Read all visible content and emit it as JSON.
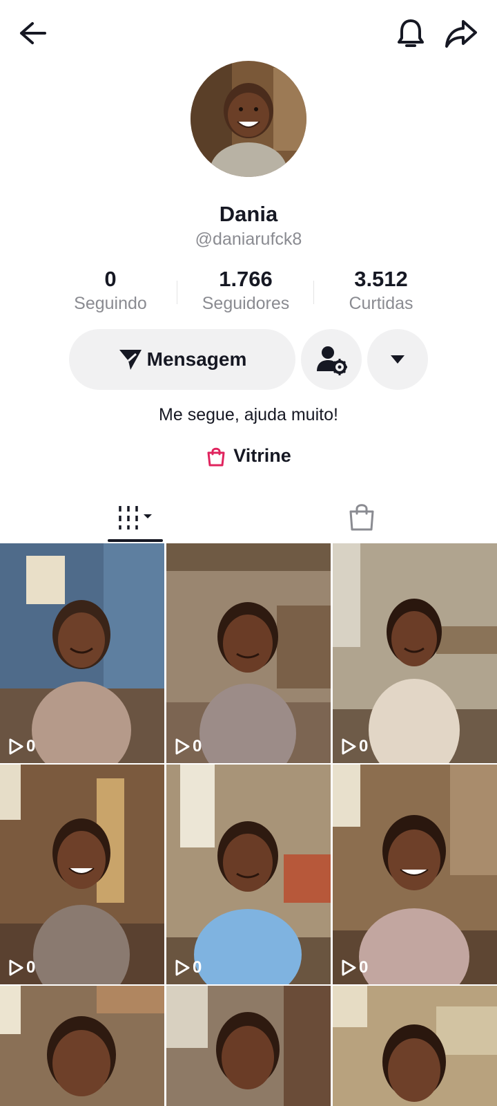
{
  "profile": {
    "name": "Dania",
    "handle": "@daniarufck8",
    "bio": "Me segue, ajuda muito!"
  },
  "stats": [
    {
      "value": "0",
      "label": "Seguindo"
    },
    {
      "value": "1.766",
      "label": "Seguidores"
    },
    {
      "value": "3.512",
      "label": "Curtidas"
    }
  ],
  "actions": {
    "message_label": "Mensagem"
  },
  "showcase": {
    "label": "Vitrine",
    "accent": "#e0245e"
  },
  "videos": [
    {
      "views": "0"
    },
    {
      "views": "0"
    },
    {
      "views": "0"
    },
    {
      "views": "0"
    },
    {
      "views": "0"
    },
    {
      "views": "0"
    },
    {
      "views": ""
    },
    {
      "views": ""
    },
    {
      "views": ""
    }
  ],
  "icons": [
    "back-arrow-icon",
    "bell-icon",
    "share-icon",
    "send-icon",
    "person-settings-icon",
    "caret-down-icon",
    "shopping-bag-icon",
    "grid-filter-icon",
    "play-icon"
  ]
}
